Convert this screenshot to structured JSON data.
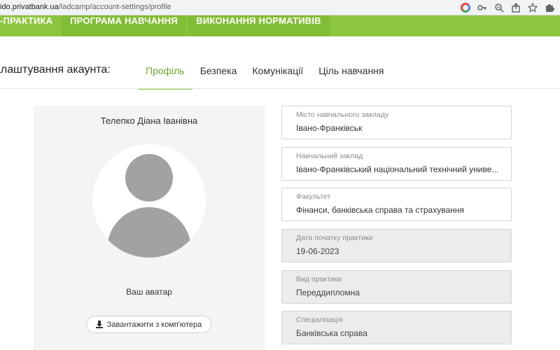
{
  "browser": {
    "url_host": "ido.privatbank.ua",
    "url_path": "/ladcamp/account-settings/profile",
    "icons": [
      "google-icon",
      "key-icon",
      "zoom-icon",
      "share-icon",
      "star-icon",
      "extension-icon"
    ]
  },
  "nav": {
    "items": [
      {
        "label": "-ПРАКТИКА"
      },
      {
        "label": "ПРОГРАМА НАВЧАННЯ"
      },
      {
        "label": "ВИКОНАННЯ НОРМАТИВІВ"
      }
    ],
    "color": "#8cc63f"
  },
  "settings": {
    "title": "алаштування акаунта:",
    "tabs": [
      {
        "label": "Профіль",
        "active": true
      },
      {
        "label": "Безпека",
        "active": false
      },
      {
        "label": "Комунікації",
        "active": false
      },
      {
        "label": "Ціль навчання",
        "active": false
      }
    ],
    "accent": "#6aaa2f"
  },
  "profile": {
    "name": "Телепко Діана Іванівна",
    "avatar_label": "Ваш аватар",
    "upload_label": "Завантажити з комп'ютера"
  },
  "fields": [
    {
      "label": "Місто навчального закладу",
      "value": "Івано-Франківськ",
      "disabled": false
    },
    {
      "label": "Навчальний заклад",
      "value": "Івано-Франківський національний технічний униве...",
      "disabled": false
    },
    {
      "label": "Факультет",
      "value": "Фінанси, банківська справа та страхування",
      "disabled": false
    },
    {
      "label": "Дата початку практики",
      "value": "19-06-2023",
      "disabled": true
    },
    {
      "label": "Вид практики",
      "value": "Переддипломна",
      "disabled": true
    },
    {
      "label": "Спеціалізація",
      "value": "Банківська справа",
      "disabled": true
    }
  ]
}
